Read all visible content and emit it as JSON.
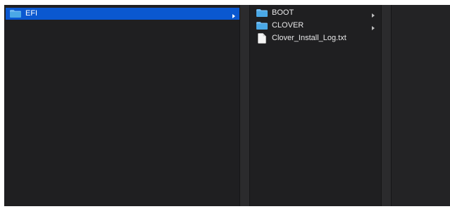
{
  "column1": {
    "items": [
      {
        "label": "EFI",
        "icon": "folder-icon",
        "selected": true,
        "has_children": true
      }
    ]
  },
  "column2": {
    "items": [
      {
        "label": "BOOT",
        "icon": "folder-icon",
        "selected": false,
        "has_children": true
      },
      {
        "label": "CLOVER",
        "icon": "folder-icon",
        "selected": false,
        "has_children": true
      },
      {
        "label": "Clover_Install_Log.txt",
        "icon": "file-icon",
        "selected": false,
        "has_children": false
      }
    ]
  },
  "colors": {
    "background": "#1f1f21",
    "selection": "#0a58d0",
    "folder": "#4aa8e6",
    "text": "#e9e9ea"
  }
}
